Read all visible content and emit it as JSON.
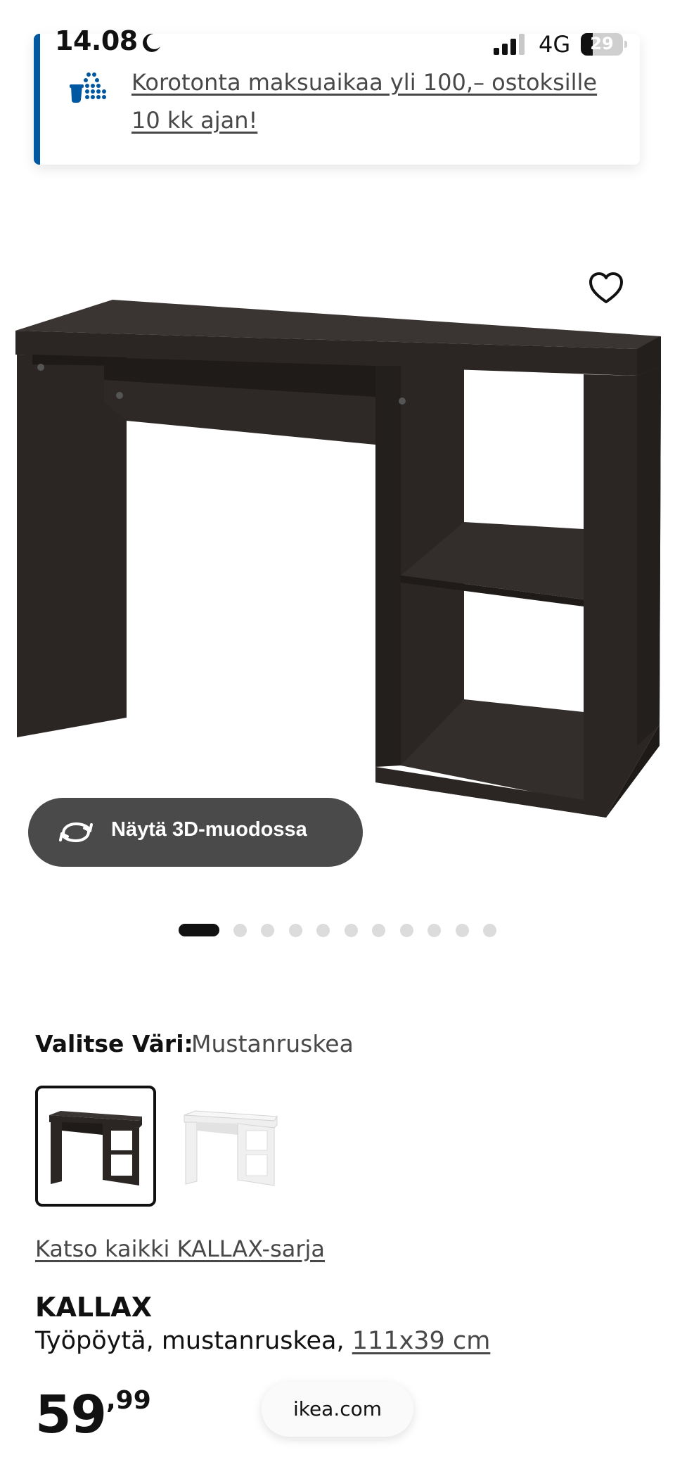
{
  "status_bar": {
    "time": "14.08",
    "network": "4G",
    "battery": "29",
    "battery_level_percent": 29
  },
  "promo": {
    "text": "Korotonta maksuaikaa yli 100,– ostoksille 10 kk ajan!",
    "accent_color": "#0058a3"
  },
  "product_image": {
    "alt": "KALLAX työpöytä, mustanruskea"
  },
  "view_3d": {
    "label": "Näytä 3D-muodossa",
    "icon": "rotate-3d-icon"
  },
  "carousel": {
    "total": 11,
    "active_index": 0
  },
  "color_select": {
    "label": "Valitse Väri:",
    "value": "Mustanruskea",
    "options": [
      {
        "name": "Mustanruskea",
        "color": "#2b2624",
        "selected": true
      },
      {
        "name": "Valkoinen",
        "color": "#f2f2f2",
        "selected": false
      }
    ]
  },
  "series_link": "Katso kaikki KALLAX-sarja",
  "product": {
    "name": "KALLAX",
    "description": "Työpöytä, mustanruskea,",
    "size": "111x39 cm",
    "price_integer": "59",
    "price_decimal": ",99"
  },
  "browser": {
    "domain": "ikea.com"
  },
  "colors": {
    "promo_accent": "#0058a3",
    "button_dark": "#4a4a4a",
    "desk_color": "#2b2624"
  }
}
